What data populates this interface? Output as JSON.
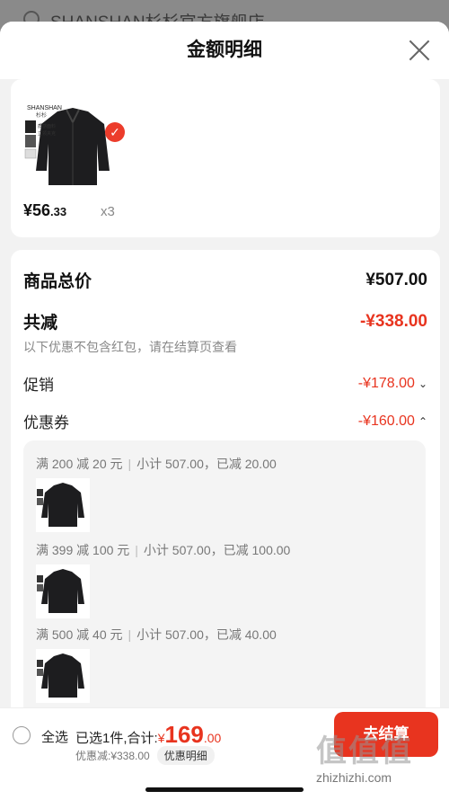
{
  "background": {
    "store_title": "SHANSHAN杉杉官方旗舰店"
  },
  "sheet": {
    "title": "金额明细",
    "close_icon": "close-icon"
  },
  "product": {
    "brand_text": "SHANSHAN",
    "price_int": "¥56",
    "price_dec": ".33",
    "quantity": "x3",
    "selected": true
  },
  "summary": {
    "total_label": "商品总价",
    "total_value": "¥507.00",
    "reduce_label": "共减",
    "reduce_value": "-¥338.00",
    "note": "以下优惠不包含红包，请在结算页查看",
    "promo_label": "促销",
    "promo_value": "-¥178.00",
    "coupon_label": "优惠券",
    "coupon_value": "-¥160.00"
  },
  "coupons": [
    {
      "rule": "满 200 减 20 元",
      "detail": "小计 507.00，已减 20.00"
    },
    {
      "rule": "满 399 减 100 元",
      "detail": "小计 507.00，已减 100.00"
    },
    {
      "rule": "满 500 减 40 元",
      "detail": "小计 507.00，已减 40.00"
    }
  ],
  "bottom": {
    "select_all": "全选",
    "selected_text": "已选1件,合计:",
    "total_yen": "¥",
    "total_int": "169",
    "total_dec": ".00",
    "discount_text": "优惠减:¥338.00",
    "detail_label": "优惠明细",
    "checkout_label": "去结算"
  },
  "watermark": {
    "logo": "值值值",
    "url": "zhizhizhi.com"
  },
  "colors": {
    "accent_red": "#e8341f",
    "badge_red": "#ec3c2b"
  }
}
